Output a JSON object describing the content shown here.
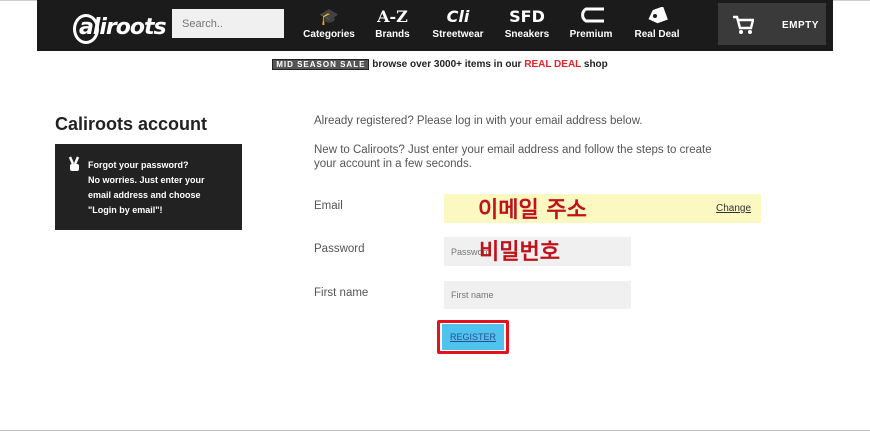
{
  "header": {
    "logo_text": "aliroots",
    "search_placeholder": "Search..",
    "nav": [
      {
        "icon": "🎓",
        "label": "Categories"
      },
      {
        "icon": "A-Z",
        "label": "Brands"
      },
      {
        "icon": "Cli",
        "label": "Streetwear"
      },
      {
        "icon": "SFD",
        "label": "Sneakers"
      },
      {
        "icon": "⌐",
        "label": "Premium"
      },
      {
        "icon": "◈",
        "label": "Real Deal"
      }
    ],
    "cart_label": "EMPTY"
  },
  "promo": {
    "tag": "MID SEASON SALE",
    "text": "browse over 3000+ items in our",
    "highlight": "REAL DEAL",
    "suffix": "shop"
  },
  "sidebar": {
    "title": "Caliroots account",
    "info_lines": [
      "Forgot your password?",
      "No worries. Just enter your",
      "email address and choose",
      "\"Login by email\"!"
    ]
  },
  "main": {
    "registered_text": "Already registered? Please log in with your email address below.",
    "new_text_line1": "New to Caliroots? Just enter your email address and follow the steps to create",
    "new_text_line2": "your account in a few seconds.",
    "email_label": "Email",
    "email_value_annotation": "이메일 주소",
    "change_label": "Change",
    "password_label": "Password",
    "password_placeholder": "Password",
    "password_annotation": "비밀번호",
    "firstname_label": "First name",
    "firstname_placeholder": "First name",
    "register_label": "REGISTER"
  }
}
